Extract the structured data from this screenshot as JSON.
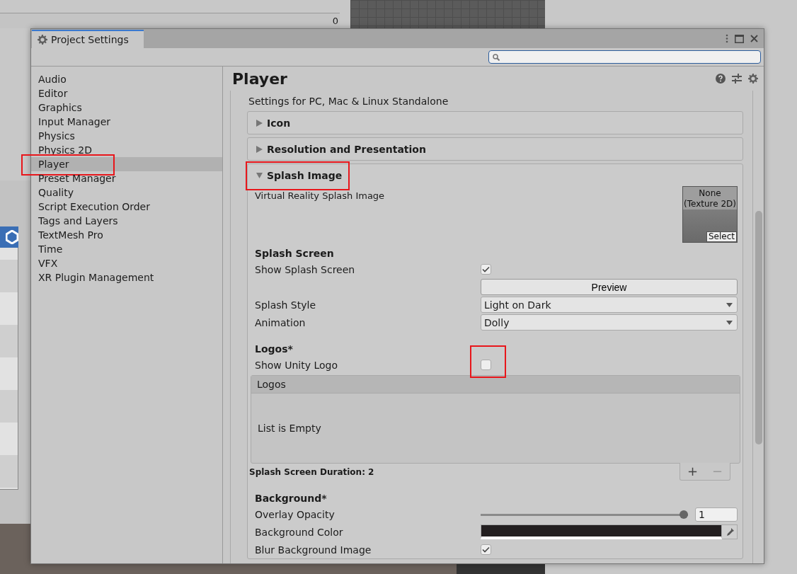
{
  "background_editor": {
    "counter": "0"
  },
  "window": {
    "title": "Project Settings"
  },
  "sidebar": {
    "items": [
      {
        "label": "Audio",
        "selected": false,
        "highlighted": false
      },
      {
        "label": "Editor",
        "selected": false,
        "highlighted": false
      },
      {
        "label": "Graphics",
        "selected": false,
        "highlighted": false
      },
      {
        "label": "Input Manager",
        "selected": false,
        "highlighted": false
      },
      {
        "label": "Physics",
        "selected": false,
        "highlighted": false
      },
      {
        "label": "Physics 2D",
        "selected": false,
        "highlighted": false
      },
      {
        "label": "Player",
        "selected": true,
        "highlighted": true
      },
      {
        "label": "Preset Manager",
        "selected": false,
        "highlighted": false
      },
      {
        "label": "Quality",
        "selected": false,
        "highlighted": false
      },
      {
        "label": "Script Execution Order",
        "selected": false,
        "highlighted": false
      },
      {
        "label": "Tags and Layers",
        "selected": false,
        "highlighted": false
      },
      {
        "label": "TextMesh Pro",
        "selected": false,
        "highlighted": false
      },
      {
        "label": "Time",
        "selected": false,
        "highlighted": false
      },
      {
        "label": "VFX",
        "selected": false,
        "highlighted": false
      },
      {
        "label": "XR Plugin Management",
        "selected": false,
        "highlighted": false
      }
    ]
  },
  "inspector": {
    "title": "Player",
    "platform_caption": "Settings for PC, Mac & Linux Standalone",
    "sections": [
      {
        "title": "Icon",
        "expanded": false,
        "highlighted": false
      },
      {
        "title": "Resolution and Presentation",
        "expanded": false,
        "highlighted": false
      },
      {
        "title": "Splash Image",
        "expanded": true,
        "highlighted": true
      }
    ],
    "splash": {
      "vr_label": "Virtual Reality Splash Image",
      "texture_slot": {
        "line1": "None",
        "line2": "(Texture 2D)",
        "button": "Select"
      },
      "rows": [
        {
          "kind": "heading",
          "label": "Splash Screen"
        },
        {
          "kind": "checkbox",
          "label": "Show Splash Screen",
          "checked": true,
          "highlighted": false
        },
        {
          "kind": "button",
          "label": "Preview"
        },
        {
          "kind": "dropdown",
          "label": "Splash Style",
          "value": "Light on Dark"
        },
        {
          "kind": "dropdown",
          "label": "Animation",
          "value": "Dolly"
        },
        {
          "kind": "heading",
          "label": "Logos*"
        },
        {
          "kind": "checkbox",
          "label": "Show Unity Logo",
          "checked": false,
          "highlighted": true
        },
        {
          "kind": "list",
          "header": "Logos",
          "empty_text": "List is Empty",
          "footer": "Splash Screen Duration: 2",
          "buttons": [
            {
              "label": "+",
              "disabled": false
            },
            {
              "label": "−",
              "disabled": true
            }
          ]
        },
        {
          "kind": "heading",
          "label": "Background*"
        },
        {
          "kind": "slider",
          "label": "Overlay Opacity",
          "level": 1,
          "value": "1"
        },
        {
          "kind": "color",
          "label": "Background Color",
          "color": "#231f20"
        },
        {
          "kind": "checkbox",
          "label": "Blur Background Image",
          "checked": true,
          "highlighted": false
        }
      ]
    }
  }
}
